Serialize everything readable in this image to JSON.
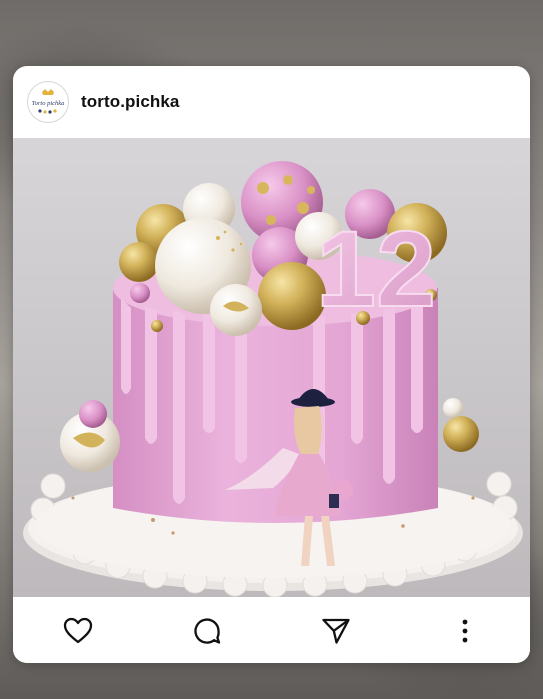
{
  "post": {
    "username": "torto.pichka",
    "avatar_text": "Torto pichka",
    "image_alt": "pink drip birthday cake with gold and white spheres, number 12 topper and a fashion girl figure"
  },
  "actions": {
    "like_icon": "heart-icon",
    "comment_icon": "comment-bubble-icon",
    "share_icon": "send-icon",
    "more_icon": "more-vertical-icon"
  },
  "cake": {
    "topper_number": "12",
    "colors": {
      "frosting": "#e6a9d6",
      "drip": "#eab7dd",
      "gold": "#c9a74a",
      "pearl": "#f3eee6",
      "board": "#f4f1ee",
      "background": "#cfcdcf"
    }
  }
}
